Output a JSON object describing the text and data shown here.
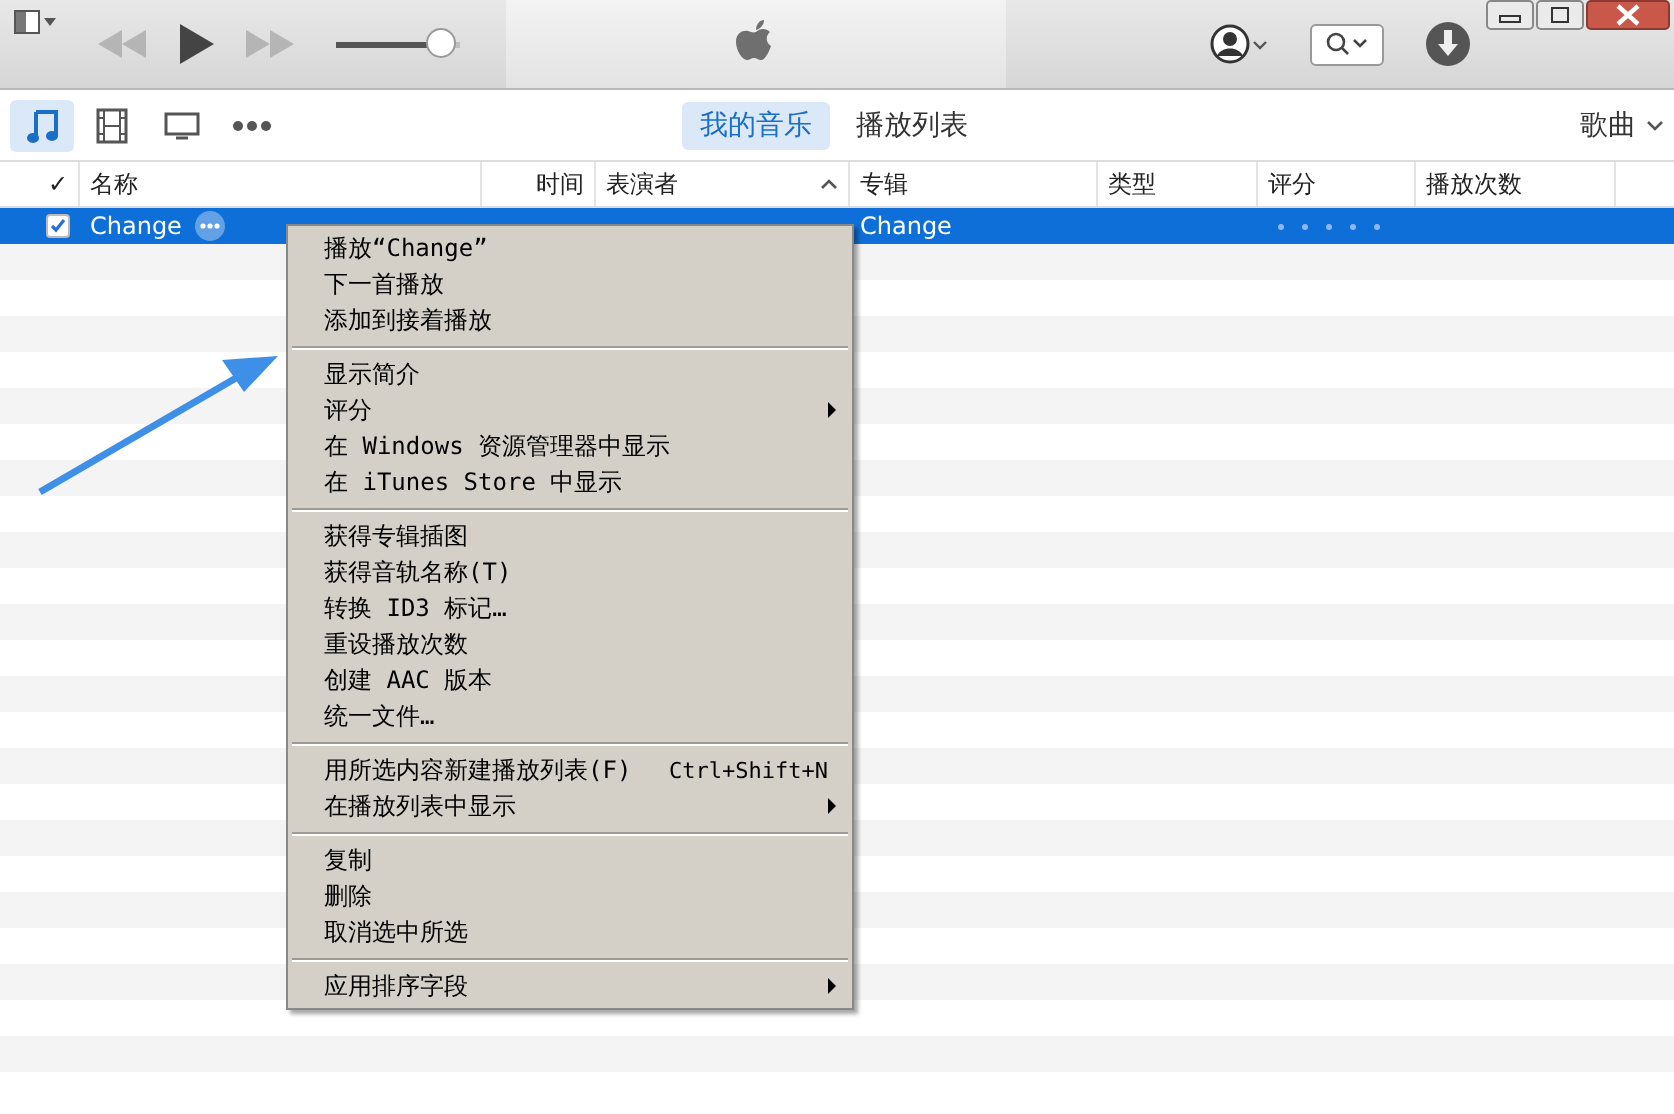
{
  "toolbar": {
    "volume": {
      "level": 0.85
    },
    "view_tabs": [
      {
        "label": "我的音乐",
        "selected": true
      },
      {
        "label": "播放列表",
        "selected": false
      }
    ],
    "view_menu": "歌曲"
  },
  "media_kinds": [
    {
      "kind": "music",
      "selected": true
    },
    {
      "kind": "movies",
      "selected": false
    },
    {
      "kind": "tv",
      "selected": false
    },
    {
      "kind": "more",
      "selected": false
    }
  ],
  "table": {
    "columns": [
      "✓",
      "名称",
      "时间",
      "表演者",
      "专辑",
      "类型",
      "评分",
      "播放次数"
    ],
    "rows": [
      {
        "checked": true,
        "selected": true,
        "name": "Change",
        "album": "Change"
      }
    ]
  },
  "context_menu": {
    "items": [
      {
        "kind": "item",
        "label": "播放“Change”"
      },
      {
        "kind": "item",
        "label": "下一首播放"
      },
      {
        "kind": "item",
        "label": "添加到接着播放"
      },
      {
        "kind": "separator"
      },
      {
        "kind": "item",
        "label": "显示简介"
      },
      {
        "kind": "item",
        "label": "评分",
        "submenu": true
      },
      {
        "kind": "item",
        "label": "在 Windows 资源管理器中显示"
      },
      {
        "kind": "item",
        "label": "在 iTunes Store 中显示"
      },
      {
        "kind": "separator"
      },
      {
        "kind": "item",
        "label": "获得专辑插图"
      },
      {
        "kind": "item",
        "label": "获得音轨名称(T)"
      },
      {
        "kind": "item",
        "label": "转换 ID3 标记…"
      },
      {
        "kind": "item",
        "label": "重设播放次数"
      },
      {
        "kind": "item",
        "label": "创建 AAC 版本"
      },
      {
        "kind": "item",
        "label": "统一文件…"
      },
      {
        "kind": "separator"
      },
      {
        "kind": "item",
        "label": "用所选内容新建播放列表(F)",
        "shortcut": "Ctrl+Shift+N"
      },
      {
        "kind": "item",
        "label": "在播放列表中显示",
        "submenu": true
      },
      {
        "kind": "separator"
      },
      {
        "kind": "item",
        "label": "复制"
      },
      {
        "kind": "item",
        "label": "删除"
      },
      {
        "kind": "item",
        "label": "取消选中所选"
      },
      {
        "kind": "separator"
      },
      {
        "kind": "item",
        "label": "应用排序字段",
        "submenu": true
      }
    ]
  }
}
